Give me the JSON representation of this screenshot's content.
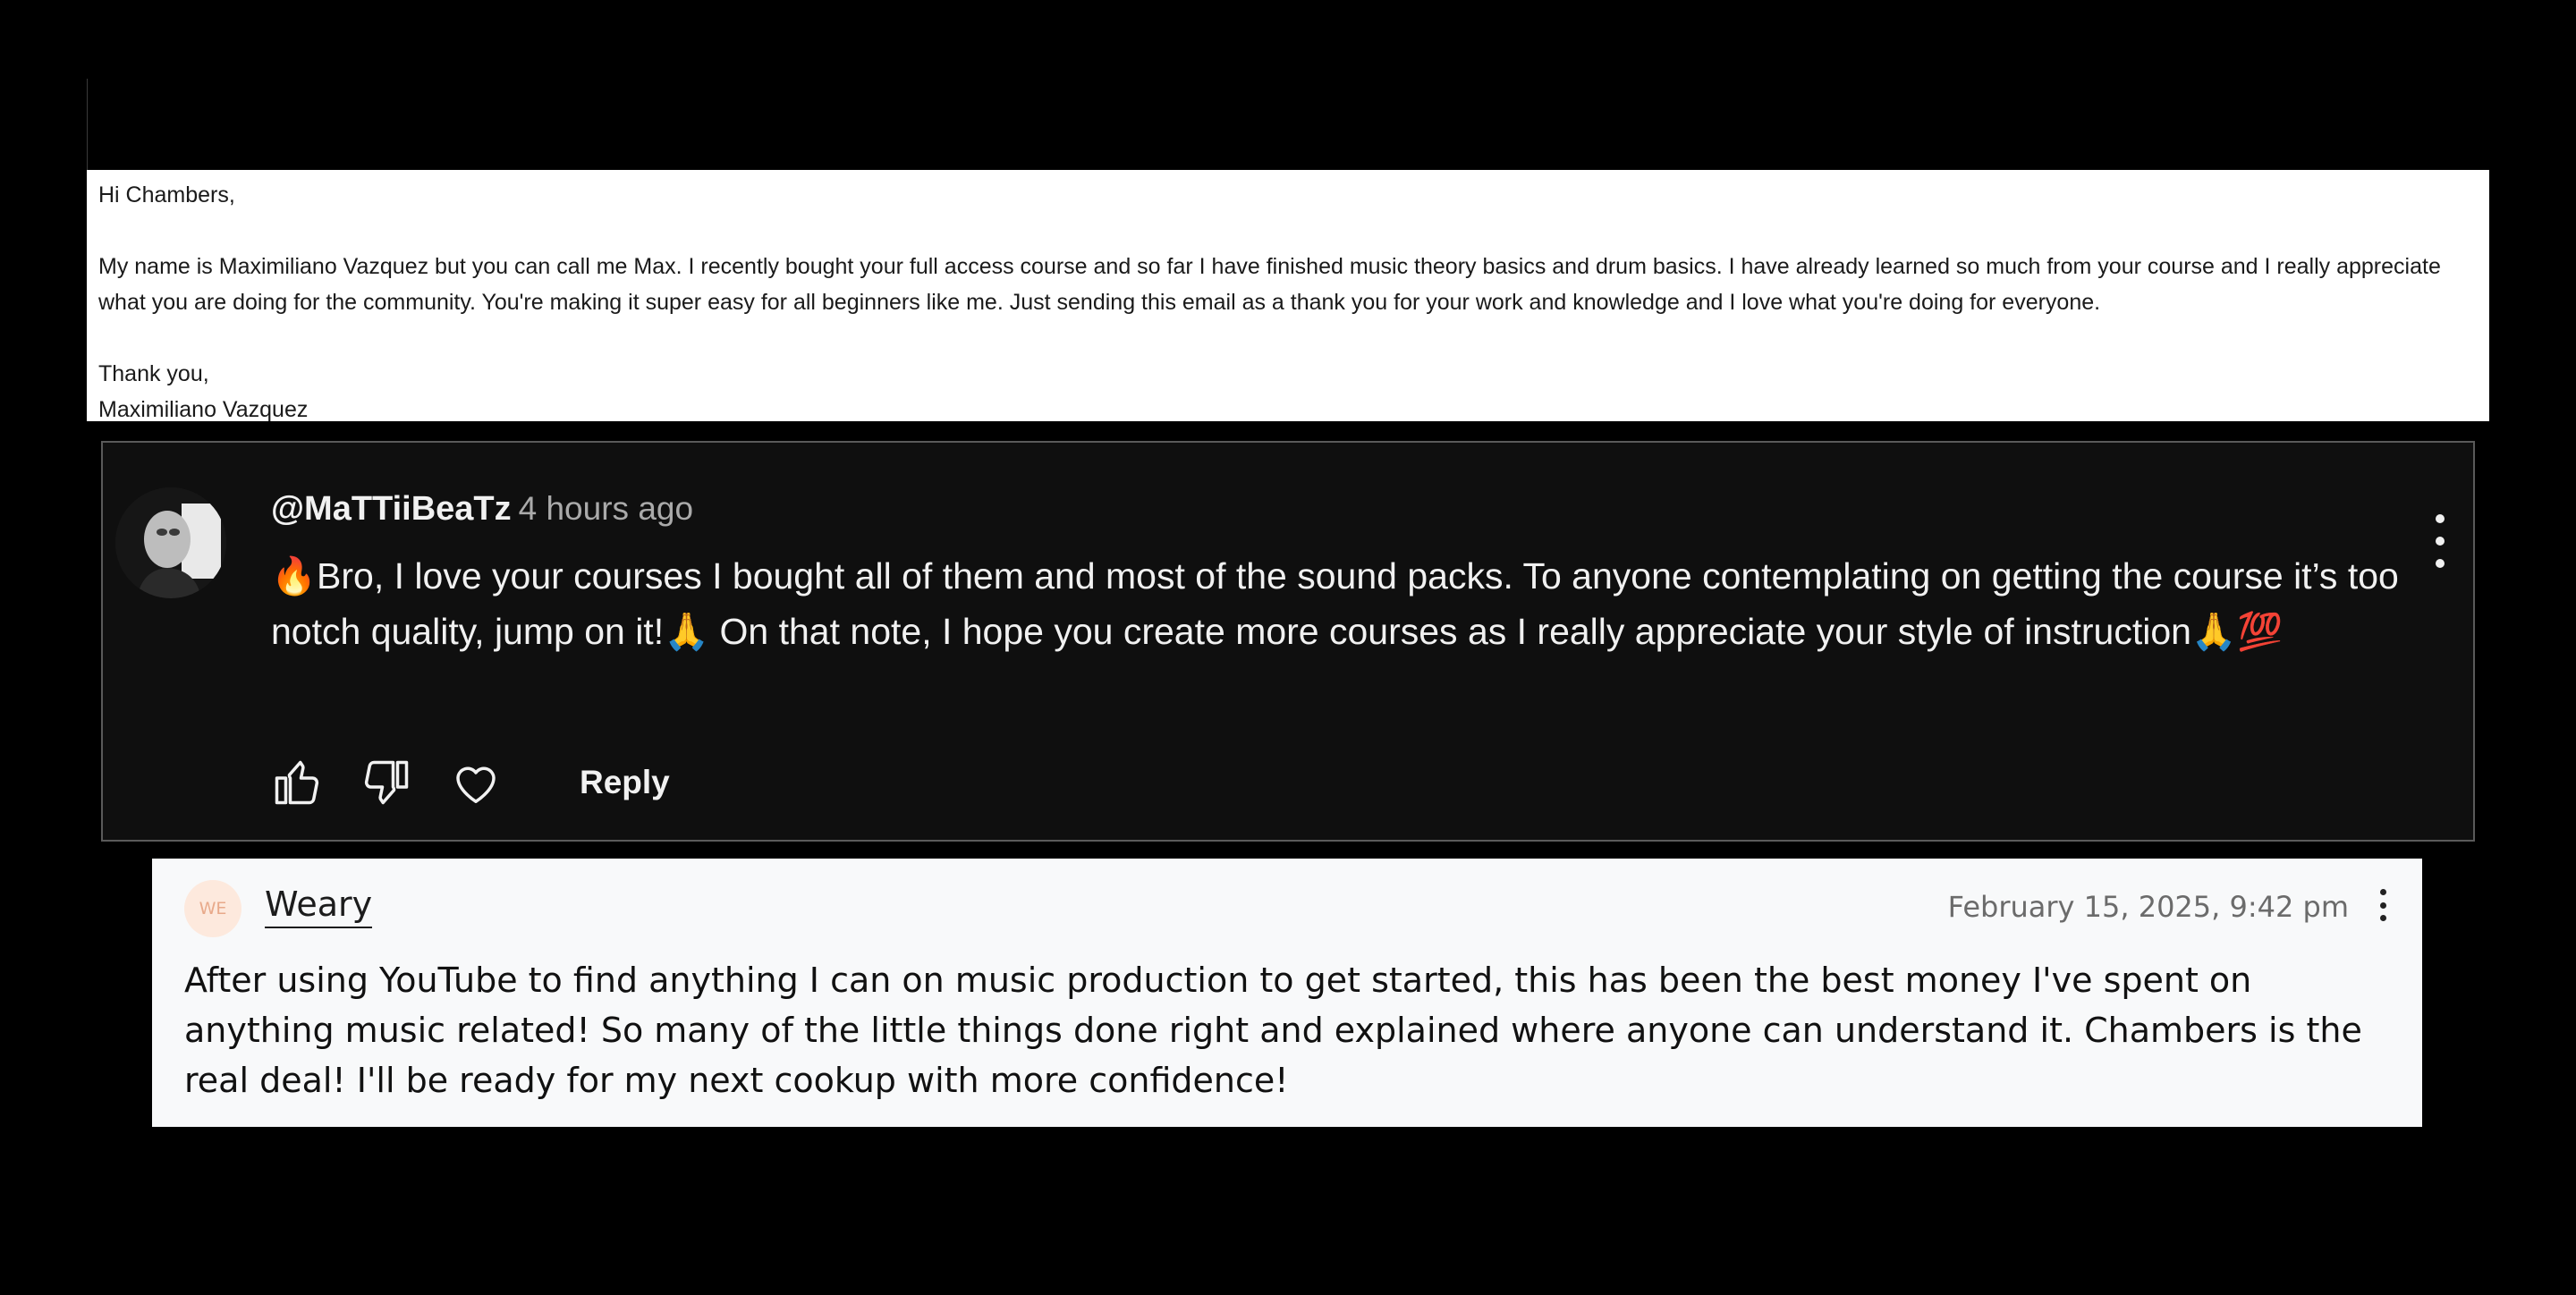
{
  "email": {
    "greeting": "Hi Chambers,",
    "body": "My name is Maximiliano Vazquez but you can call me Max. I recently bought your full access course and so far I have finished music theory basics and drum basics. I have already learned so much from your course and I really appreciate what you are doing for the community. You're making it super easy for all beginners like me. Just sending this email as a thank you for your work and knowledge and I love what you're doing for everyone.",
    "signoff": "Thank you,",
    "signature": "Maximiliano Vazquez"
  },
  "youtube_comment": {
    "author": "@MaTTiiBeaTz",
    "time": "4 hours ago",
    "text": "🔥Bro, I love your courses I bought all of them and most of the sound packs. To anyone contemplating on getting the course it’s too notch quality, jump on it!🙏 On that note, I hope you create more courses as I really appreciate your style of instruction🙏💯",
    "reply_label": "Reply",
    "icons": {
      "like": "thumbs-up-icon",
      "dislike": "thumbs-down-icon",
      "heart": "heart-icon",
      "menu": "more-vertical-icon"
    }
  },
  "review": {
    "avatar_initials": "WE",
    "author": "Weary",
    "date": "February 15, 2025, 9:42 pm",
    "text": "After using YouTube to find anything I can on music production to get started, this has been the best money I've spent on anything music related! So many of the little things done right and explained where anyone can understand it. Chambers is the real deal! I'll be ready for my next cookup with more confidence!"
  },
  "colors": {
    "background": "#000000",
    "email_bg": "#ffffff",
    "youtube_bg": "#0f0f0f",
    "youtube_text": "#f1f1f1",
    "youtube_meta": "#aaaaaa",
    "review_bg": "#f8f9fa",
    "review_avatar_bg": "#fde9dd"
  }
}
